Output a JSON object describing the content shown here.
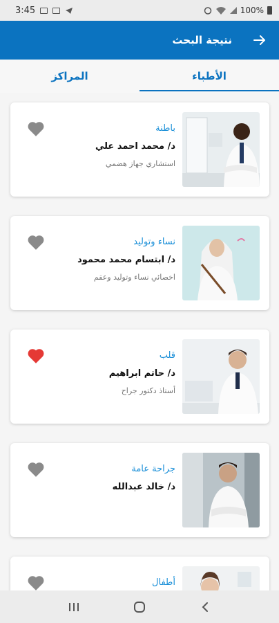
{
  "status_bar": {
    "time": "3:45",
    "battery": "100%"
  },
  "app_bar": {
    "title": "نتيجة البحث"
  },
  "tabs": [
    {
      "label": "الأطباء",
      "active": true
    },
    {
      "label": "المراكز",
      "active": false
    }
  ],
  "doctors": [
    {
      "specialty": "باطنة",
      "name": "د/ محمد احمد علي",
      "title": "استشاري جهاز هضمي",
      "favorite": false
    },
    {
      "specialty": "نساء وتوليد",
      "name": "د/ ابتسام محمد محمود",
      "title": "اخصائي نساء وتوليد وعقم",
      "favorite": false
    },
    {
      "specialty": "قلب",
      "name": "د/ حاتم ابراهيم",
      "title": "أستاذ دكتور جراح",
      "favorite": true
    },
    {
      "specialty": "جراحة عامة",
      "name": "د/ خالد عبدالله",
      "title": "",
      "favorite": false
    },
    {
      "specialty": "أطفال",
      "name": "",
      "title": "",
      "favorite": false
    }
  ],
  "colors": {
    "primary": "#0b73c0",
    "specialty": "#1a8fd8",
    "heart_active": "#e53935",
    "heart_inactive": "#8a8a8a"
  }
}
